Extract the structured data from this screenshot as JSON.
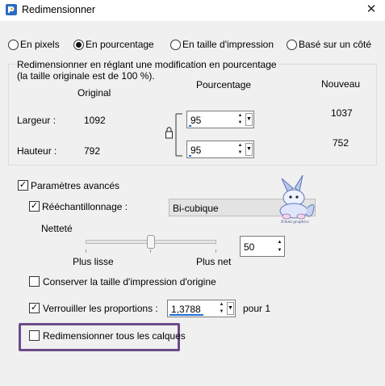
{
  "window": {
    "title": "Redimensionner",
    "close_glyph": "✕",
    "icon": "paint-shop-pro-icon"
  },
  "mode_options": [
    {
      "label": "En pixels",
      "selected": false
    },
    {
      "label": "En pourcentage",
      "selected": true
    },
    {
      "label": "En taille d'impression",
      "selected": false
    },
    {
      "label": "Basé sur un côté",
      "selected": false
    }
  ],
  "resize_group": {
    "description_line1": "Redimensionner en réglant une modification en pourcentage",
    "description_line2": "(la taille originale est de 100 %).",
    "col_original": "Original",
    "col_percent": "Pourcentage",
    "col_new": "Nouveau",
    "width": {
      "label": "Largeur :",
      "original": "1092",
      "percent": "95",
      "new": "1037"
    },
    "height": {
      "label": "Hauteur :",
      "original": "792",
      "percent": "95",
      "new": "752"
    }
  },
  "advanced": {
    "label": "Paramètres avancés",
    "checked": true,
    "resampling": {
      "label": "Rééchantillonnage :",
      "checked": true,
      "method": "Bi-cubique"
    },
    "sharpness": {
      "label": "Netteté",
      "value": "50",
      "level": 0.5,
      "min_label": "Plus lisse",
      "max_label": "Plus net"
    },
    "keep_print_size": {
      "label": "Conserver la taille d'impression d'origine",
      "checked": false
    },
    "lock_ratio": {
      "label": "Verrouiller les proportions :",
      "checked": true,
      "value": "1,3788",
      "suffix": "pour 1"
    },
    "all_layers": {
      "label": "Redimensionner tous les calques",
      "checked": false
    }
  },
  "watermark_text": "Tchoki graphics",
  "colors": {
    "highlight_frame": "#6c4a8a",
    "spin_marker": "#1f6fd6"
  }
}
